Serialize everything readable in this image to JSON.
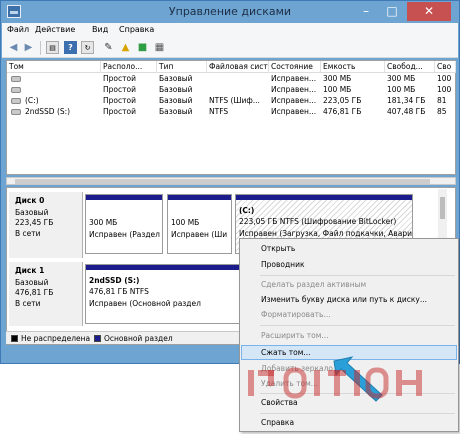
{
  "window": {
    "title": "Управление дисками"
  },
  "menubar": {
    "items": [
      "Файл",
      "Действие",
      "Вид",
      "Справка"
    ]
  },
  "toolbar": {
    "icons": [
      "back-icon",
      "forward-icon",
      "properties-icon",
      "help-icon",
      "refresh-icon",
      "folder-icon",
      "open-icon",
      "disk-icon",
      "settings-icon"
    ]
  },
  "volumes": {
    "columns": [
      "Том",
      "Располо...",
      "Тип",
      "Файловая система",
      "Состояние",
      "Емкость",
      "Свобод...",
      "Сво"
    ],
    "rows": [
      [
        "",
        "Простой",
        "Базовый",
        "",
        "Исправен...",
        "300 МБ",
        "300 МБ",
        "100"
      ],
      [
        "",
        "Простой",
        "Базовый",
        "",
        "Исправен...",
        "100 МБ",
        "100 МБ",
        "100"
      ],
      [
        "(C:)",
        "Простой",
        "Базовый",
        "NTFS (Шиф...",
        "Исправен...",
        "223,05 ГБ",
        "181,34 ГБ",
        "81"
      ],
      [
        "2ndSSD (S:)",
        "Простой",
        "Базовый",
        "NTFS",
        "Исправен...",
        "476,81 ГБ",
        "407,48 ГБ",
        "85"
      ]
    ]
  },
  "disks": [
    {
      "name": "Диск 0",
      "type": "Базовый",
      "size": "223,45 ГБ",
      "status": "В сети",
      "partitions": [
        {
          "label": "",
          "size": "300 МБ",
          "status": "Исправен (Раздел"
        },
        {
          "label": "",
          "size": "100 МБ",
          "status": "Исправен (Ши"
        },
        {
          "label": "(C:)",
          "size": "223,05 ГБ NTFS (Шифрование BitLocker)",
          "status": "Исправен (Загрузка, Файл подкачки, Авари"
        }
      ]
    },
    {
      "name": "Диск 1",
      "type": "Базовый",
      "size": "476,81 ГБ",
      "status": "В сети",
      "partitions": [
        {
          "label": "2ndSSD  (S:)",
          "size": "476,81 ГБ NTFS",
          "status": "Исправен (Основной раздел"
        }
      ]
    }
  ],
  "legend": [
    {
      "label": "Не распределена",
      "color": "#000000"
    },
    {
      "label": "Основной раздел",
      "color": "#1c1c8c"
    }
  ],
  "context_menu": {
    "items": [
      {
        "label": "Открыть",
        "enabled": true
      },
      {
        "label": "Проводник",
        "enabled": true
      },
      {
        "label": "Сделать раздел активным",
        "enabled": false
      },
      {
        "label": "Изменить букву диска или путь к диску...",
        "enabled": true
      },
      {
        "label": "Форматировать...",
        "enabled": false
      },
      {
        "label": "Расширить том...",
        "enabled": false
      },
      {
        "label": "Сжать том...",
        "enabled": true,
        "highlighted": true
      },
      {
        "label": "Добавить зеркало...",
        "enabled": false
      },
      {
        "label": "Удалить том...",
        "enabled": false
      },
      {
        "label": "Свойства",
        "enabled": true
      },
      {
        "label": "Справка",
        "enabled": true
      }
    ]
  },
  "colors": {
    "titlebar": "#6ea4d2",
    "partition_bar": "#1c1c8c",
    "highlight": "#d5e6f7",
    "arrow": "#2a9fd8"
  }
}
